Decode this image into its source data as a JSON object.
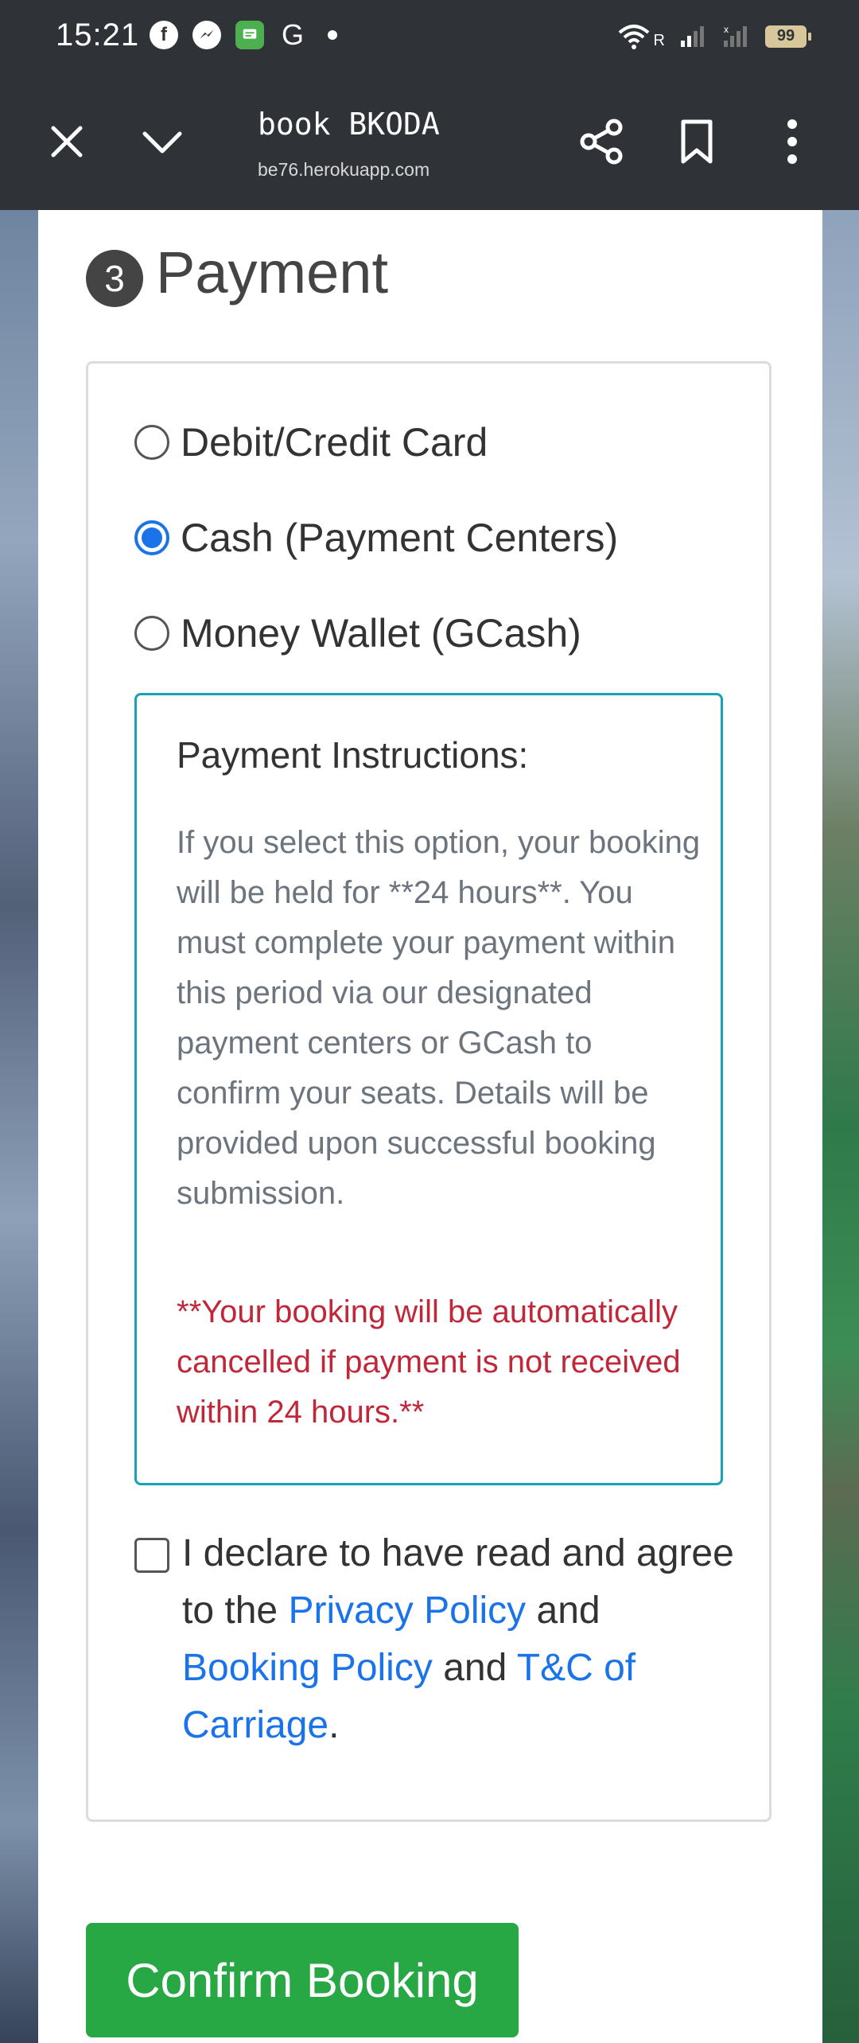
{
  "status_bar": {
    "time": "15:21",
    "notification_icons": [
      "facebook-icon",
      "messenger-icon",
      "messages-icon",
      "google-icon"
    ],
    "battery": "99",
    "network_label": "R"
  },
  "browser": {
    "title": "book BKODA",
    "url": "be76.herokuapp.com",
    "buttons": [
      "close-icon",
      "chevron-down-icon",
      "share-icon",
      "bookmark-icon",
      "more-icon"
    ]
  },
  "payment": {
    "step_number": "3",
    "title": "Payment",
    "options": [
      {
        "label": "Debit/Credit Card",
        "selected": false
      },
      {
        "label": "Cash (Payment Centers)",
        "selected": true
      },
      {
        "label": "Money Wallet (GCash)",
        "selected": false
      }
    ],
    "instructions": {
      "title": "Payment Instructions:",
      "body": "If you select this option, your booking will be held for **24 hours**. You must complete your payment within this period via our designated payment centers or GCash to confirm your seats. Details will be provided upon successful booking submission.",
      "warning": "**Your booking will be automatically cancelled if payment is not received within 24 hours.**"
    },
    "agreement": {
      "checked": false,
      "text_1": "I declare to have read and agree to the",
      "link_privacy": "Privacy Policy",
      "text_2": "and",
      "link_booking": "Booking Policy",
      "text_3": "and",
      "link_tc": "T&C of Carriage",
      "text_4": "."
    },
    "confirm_label": "Confirm Booking"
  },
  "colors": {
    "accent_blue": "#1a73e8",
    "confirm_green": "#28a745",
    "instruction_border": "#17a2b8",
    "warning_red": "#c0283a"
  }
}
